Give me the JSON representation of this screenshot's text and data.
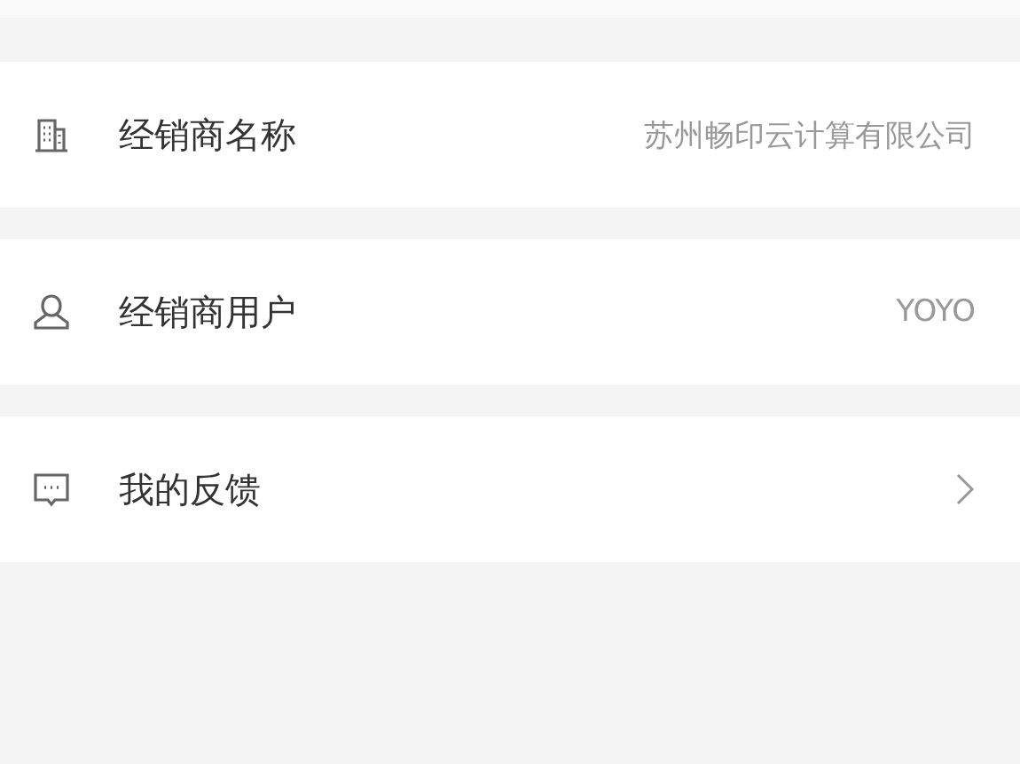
{
  "rows": [
    {
      "kind": "value",
      "label": "经销商名称",
      "value": "苏州畅印云计算有限公司"
    },
    {
      "kind": "value",
      "label": "经销商用户",
      "value": "YOYO"
    },
    {
      "kind": "link",
      "label": "我的反馈"
    }
  ]
}
